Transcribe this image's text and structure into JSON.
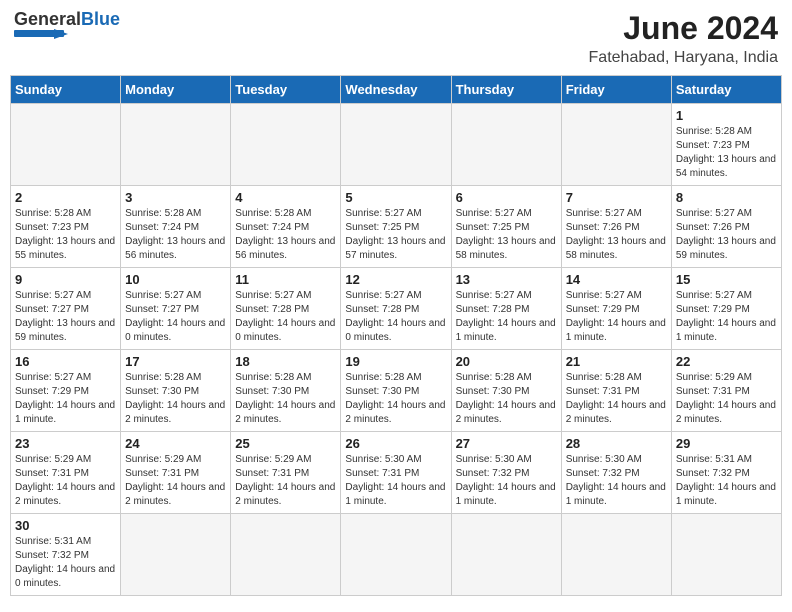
{
  "header": {
    "logo_text_general": "General",
    "logo_text_blue": "Blue",
    "month_year": "June 2024",
    "location": "Fatehabad, Haryana, India"
  },
  "days_of_week": [
    "Sunday",
    "Monday",
    "Tuesday",
    "Wednesday",
    "Thursday",
    "Friday",
    "Saturday"
  ],
  "weeks": [
    [
      {
        "day": "",
        "info": ""
      },
      {
        "day": "",
        "info": ""
      },
      {
        "day": "",
        "info": ""
      },
      {
        "day": "",
        "info": ""
      },
      {
        "day": "",
        "info": ""
      },
      {
        "day": "",
        "info": ""
      },
      {
        "day": "1",
        "info": "Sunrise: 5:28 AM\nSunset: 7:23 PM\nDaylight: 13 hours\nand 54 minutes."
      }
    ],
    [
      {
        "day": "2",
        "info": "Sunrise: 5:28 AM\nSunset: 7:23 PM\nDaylight: 13 hours\nand 55 minutes."
      },
      {
        "day": "3",
        "info": "Sunrise: 5:28 AM\nSunset: 7:24 PM\nDaylight: 13 hours\nand 56 minutes."
      },
      {
        "day": "4",
        "info": "Sunrise: 5:28 AM\nSunset: 7:24 PM\nDaylight: 13 hours\nand 56 minutes."
      },
      {
        "day": "5",
        "info": "Sunrise: 5:27 AM\nSunset: 7:25 PM\nDaylight: 13 hours\nand 57 minutes."
      },
      {
        "day": "6",
        "info": "Sunrise: 5:27 AM\nSunset: 7:25 PM\nDaylight: 13 hours\nand 58 minutes."
      },
      {
        "day": "7",
        "info": "Sunrise: 5:27 AM\nSunset: 7:26 PM\nDaylight: 13 hours\nand 58 minutes."
      },
      {
        "day": "8",
        "info": "Sunrise: 5:27 AM\nSunset: 7:26 PM\nDaylight: 13 hours\nand 59 minutes."
      }
    ],
    [
      {
        "day": "9",
        "info": "Sunrise: 5:27 AM\nSunset: 7:27 PM\nDaylight: 13 hours\nand 59 minutes."
      },
      {
        "day": "10",
        "info": "Sunrise: 5:27 AM\nSunset: 7:27 PM\nDaylight: 14 hours\nand 0 minutes."
      },
      {
        "day": "11",
        "info": "Sunrise: 5:27 AM\nSunset: 7:28 PM\nDaylight: 14 hours\nand 0 minutes."
      },
      {
        "day": "12",
        "info": "Sunrise: 5:27 AM\nSunset: 7:28 PM\nDaylight: 14 hours\nand 0 minutes."
      },
      {
        "day": "13",
        "info": "Sunrise: 5:27 AM\nSunset: 7:28 PM\nDaylight: 14 hours\nand 1 minute."
      },
      {
        "day": "14",
        "info": "Sunrise: 5:27 AM\nSunset: 7:29 PM\nDaylight: 14 hours\nand 1 minute."
      },
      {
        "day": "15",
        "info": "Sunrise: 5:27 AM\nSunset: 7:29 PM\nDaylight: 14 hours\nand 1 minute."
      }
    ],
    [
      {
        "day": "16",
        "info": "Sunrise: 5:27 AM\nSunset: 7:29 PM\nDaylight: 14 hours\nand 1 minute."
      },
      {
        "day": "17",
        "info": "Sunrise: 5:28 AM\nSunset: 7:30 PM\nDaylight: 14 hours\nand 2 minutes."
      },
      {
        "day": "18",
        "info": "Sunrise: 5:28 AM\nSunset: 7:30 PM\nDaylight: 14 hours\nand 2 minutes."
      },
      {
        "day": "19",
        "info": "Sunrise: 5:28 AM\nSunset: 7:30 PM\nDaylight: 14 hours\nand 2 minutes."
      },
      {
        "day": "20",
        "info": "Sunrise: 5:28 AM\nSunset: 7:30 PM\nDaylight: 14 hours\nand 2 minutes."
      },
      {
        "day": "21",
        "info": "Sunrise: 5:28 AM\nSunset: 7:31 PM\nDaylight: 14 hours\nand 2 minutes."
      },
      {
        "day": "22",
        "info": "Sunrise: 5:29 AM\nSunset: 7:31 PM\nDaylight: 14 hours\nand 2 minutes."
      }
    ],
    [
      {
        "day": "23",
        "info": "Sunrise: 5:29 AM\nSunset: 7:31 PM\nDaylight: 14 hours\nand 2 minutes."
      },
      {
        "day": "24",
        "info": "Sunrise: 5:29 AM\nSunset: 7:31 PM\nDaylight: 14 hours\nand 2 minutes."
      },
      {
        "day": "25",
        "info": "Sunrise: 5:29 AM\nSunset: 7:31 PM\nDaylight: 14 hours\nand 2 minutes."
      },
      {
        "day": "26",
        "info": "Sunrise: 5:30 AM\nSunset: 7:31 PM\nDaylight: 14 hours\nand 1 minute."
      },
      {
        "day": "27",
        "info": "Sunrise: 5:30 AM\nSunset: 7:32 PM\nDaylight: 14 hours\nand 1 minute."
      },
      {
        "day": "28",
        "info": "Sunrise: 5:30 AM\nSunset: 7:32 PM\nDaylight: 14 hours\nand 1 minute."
      },
      {
        "day": "29",
        "info": "Sunrise: 5:31 AM\nSunset: 7:32 PM\nDaylight: 14 hours\nand 1 minute."
      }
    ],
    [
      {
        "day": "30",
        "info": "Sunrise: 5:31 AM\nSunset: 7:32 PM\nDaylight: 14 hours\nand 0 minutes."
      },
      {
        "day": "",
        "info": ""
      },
      {
        "day": "",
        "info": ""
      },
      {
        "day": "",
        "info": ""
      },
      {
        "day": "",
        "info": ""
      },
      {
        "day": "",
        "info": ""
      },
      {
        "day": "",
        "info": ""
      }
    ]
  ]
}
